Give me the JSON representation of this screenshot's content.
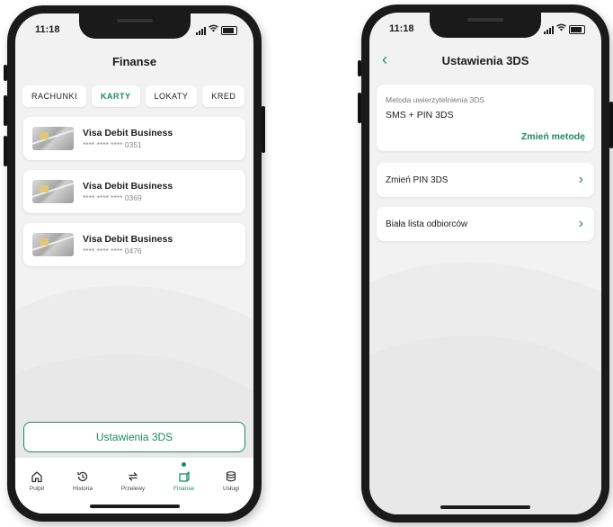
{
  "left_phone": {
    "status_time": "11:18",
    "title": "Finanse",
    "tabs": [
      {
        "label": "RACHUNKI",
        "active": false
      },
      {
        "label": "KARTY",
        "active": true
      },
      {
        "label": "LOKATY",
        "active": false
      },
      {
        "label": "KRED",
        "active": false
      }
    ],
    "cards": [
      {
        "name": "Visa Debit Business",
        "number": "**** **** **** 0351"
      },
      {
        "name": "Visa Debit Business",
        "number": "**** **** **** 0369"
      },
      {
        "name": "Visa Debit Business",
        "number": "**** **** **** 0476"
      }
    ],
    "settings_button": "Ustawienia 3DS",
    "tabbar": [
      {
        "label": "Pulpit",
        "icon": "home-icon"
      },
      {
        "label": "Historia",
        "icon": "history-icon"
      },
      {
        "label": "Przelewy",
        "icon": "transfer-icon"
      },
      {
        "label": "Finanse",
        "icon": "finance-icon",
        "active": true
      },
      {
        "label": "Usługi",
        "icon": "services-icon"
      }
    ]
  },
  "right_phone": {
    "status_time": "11:18",
    "title": "Ustawienia 3DS",
    "method_label": "Metoda uwierzytelnienia 3DS",
    "method_value": "SMS + PIN 3DS",
    "method_link": "Zmień metodę",
    "rows": [
      {
        "label": "Zmień PIN 3DS"
      },
      {
        "label": "Biała lista odbiorców"
      }
    ]
  },
  "colors": {
    "accent": "#1d8a5e",
    "background": "#f2f2f2"
  }
}
